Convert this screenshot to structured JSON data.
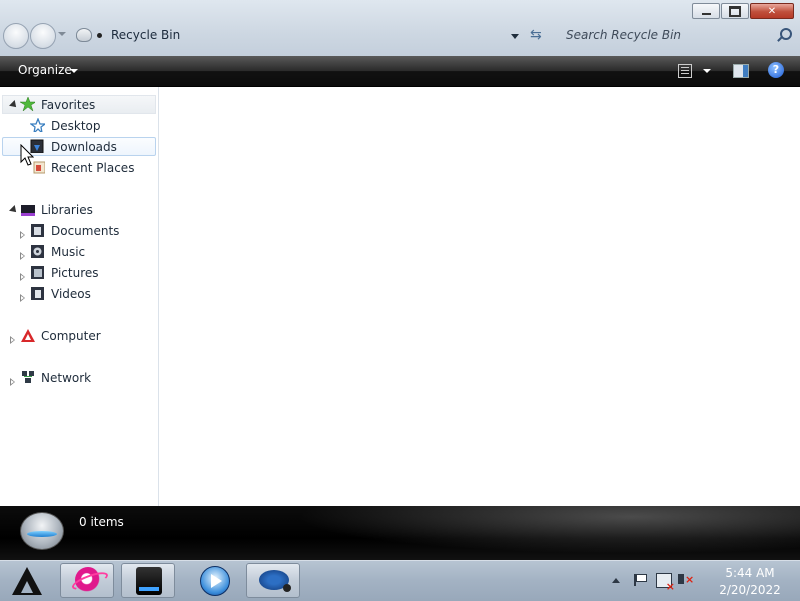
{
  "window": {
    "address": "Recycle Bin",
    "search_placeholder": "Search Recycle Bin",
    "toolbar": {
      "organize_label": "Organize"
    }
  },
  "navigation": {
    "favorites": {
      "label": "Favorites",
      "items": [
        {
          "label": "Desktop",
          "icon": "desktop-icon"
        },
        {
          "label": "Downloads",
          "icon": "downloads-icon"
        },
        {
          "label": "Recent Places",
          "icon": "recent-places-icon"
        }
      ]
    },
    "libraries": {
      "label": "Libraries",
      "items": [
        {
          "label": "Documents",
          "icon": "documents-icon"
        },
        {
          "label": "Music",
          "icon": "music-icon"
        },
        {
          "label": "Pictures",
          "icon": "pictures-icon"
        },
        {
          "label": "Videos",
          "icon": "videos-icon"
        }
      ]
    },
    "computer": {
      "label": "Computer"
    },
    "network": {
      "label": "Network"
    }
  },
  "details": {
    "items_count": "0 items"
  },
  "taskbar": {
    "apps": [
      "internet-explorer-icon",
      "windows-explorer-icon",
      "media-player-icon",
      "recycle-bin-icon"
    ],
    "clock": {
      "time": "5:44 AM",
      "date": "2/20/2022"
    }
  },
  "colors": {
    "toolbar_bg": "#111111",
    "details_bg": "#000000",
    "taskbar_bg": "#a3b2c3",
    "close_button": "#c0503c"
  }
}
